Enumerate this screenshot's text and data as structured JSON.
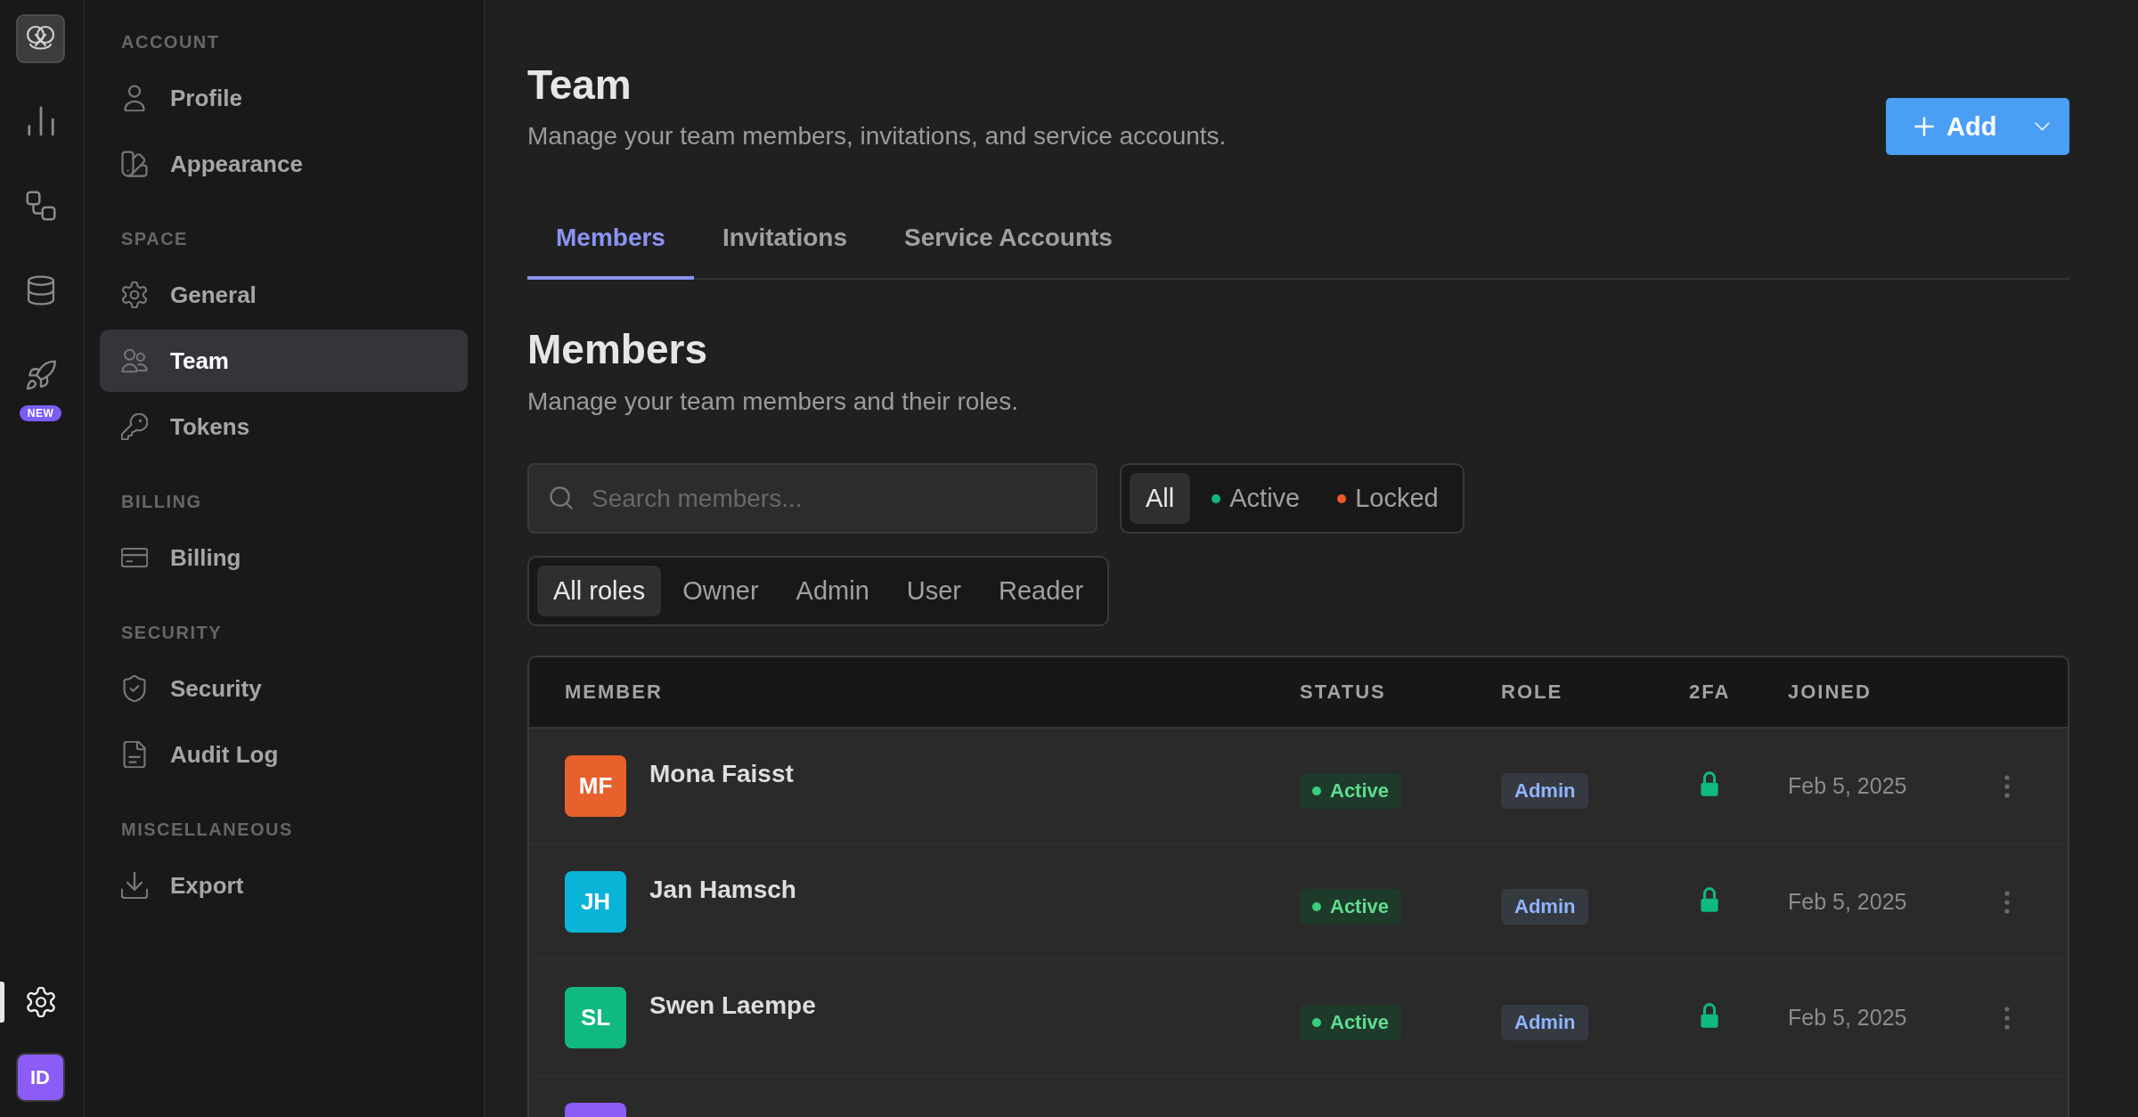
{
  "rail": {
    "top_items": [
      {
        "kind": "analytics",
        "selected": false
      },
      {
        "kind": "workflows",
        "selected": false
      },
      {
        "kind": "database",
        "selected": false
      },
      {
        "kind": "launch",
        "selected": false,
        "badge": "NEW"
      }
    ],
    "bottom_items": [
      {
        "kind": "settings",
        "selected": true
      }
    ],
    "avatar": {
      "initials": "ID"
    }
  },
  "sidebar": {
    "sections": [
      {
        "title": "ACCOUNT",
        "items": [
          {
            "kind": "profile",
            "label": "Profile",
            "selected": false
          },
          {
            "kind": "appearance",
            "label": "Appearance",
            "selected": false
          }
        ]
      },
      {
        "title": "SPACE",
        "items": [
          {
            "kind": "general",
            "label": "General",
            "selected": false
          },
          {
            "kind": "team",
            "label": "Team",
            "selected": true
          },
          {
            "kind": "tokens",
            "label": "Tokens",
            "selected": false
          }
        ]
      },
      {
        "title": "BILLING",
        "items": [
          {
            "kind": "billing",
            "label": "Billing",
            "selected": false
          }
        ]
      },
      {
        "title": "SECURITY",
        "items": [
          {
            "kind": "security",
            "label": "Security",
            "selected": false
          },
          {
            "kind": "audit_log",
            "label": "Audit Log",
            "selected": false
          }
        ]
      },
      {
        "title": "MISCELLANEOUS",
        "items": [
          {
            "kind": "export",
            "label": "Export",
            "selected": false
          }
        ]
      }
    ]
  },
  "header": {
    "title": "Team",
    "subtitle": "Manage your team members, invitations, and service accounts.",
    "add_button": {
      "label": "Add"
    }
  },
  "tabs": [
    {
      "label": "Members",
      "selected": true
    },
    {
      "label": "Invitations",
      "selected": false
    },
    {
      "label": "Service Accounts",
      "selected": false
    }
  ],
  "section": {
    "title": "Members",
    "subtitle": "Manage your team members and their roles."
  },
  "search": {
    "placeholder": "Search members..."
  },
  "status_filter": [
    {
      "label": "All",
      "selected": true
    },
    {
      "label": "Active",
      "selected": false,
      "color": "#10b981"
    },
    {
      "label": "Locked",
      "selected": false,
      "color": "#f05a28"
    }
  ],
  "role_filter": [
    {
      "label": "All roles",
      "selected": true
    },
    {
      "label": "Owner",
      "selected": false
    },
    {
      "label": "Admin",
      "selected": false
    },
    {
      "label": "User",
      "selected": false
    },
    {
      "label": "Reader",
      "selected": false
    }
  ],
  "table": {
    "columns": [
      "MEMBER",
      "STATUS",
      "ROLE",
      "2FA",
      "JOINED"
    ],
    "rows": [
      {
        "initials": "MF",
        "color": "#e8602c",
        "name": "Mona Faisst",
        "status": {
          "label": "Active",
          "kind": "active"
        },
        "role": "Admin",
        "two_factor": true,
        "joined": "Feb 5, 2025"
      },
      {
        "initials": "JH",
        "color": "#0ab4d6",
        "name": "Jan Hamsch",
        "status": {
          "label": "Active",
          "kind": "active"
        },
        "role": "Admin",
        "two_factor": true,
        "joined": "Feb 5, 2025"
      },
      {
        "initials": "SL",
        "color": "#10b981",
        "name": "Swen Laempe",
        "status": {
          "label": "Active",
          "kind": "active"
        },
        "role": "Admin",
        "two_factor": true,
        "joined": "Feb 5, 2025"
      },
      {
        "color": "#8b5cf6"
      }
    ]
  }
}
